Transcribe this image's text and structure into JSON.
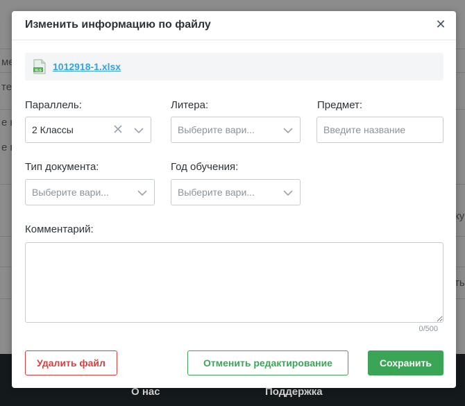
{
  "background": {
    "fragments": [
      "ме",
      "те",
      "е н",
      "е н",
      "ку",
      "ть"
    ],
    "footer": {
      "about": "О нас",
      "support": "Поддержка"
    }
  },
  "modal": {
    "title": "Изменить информацию по файлу",
    "close_glyph": "✕",
    "file": {
      "name": "1012918-1.xlsx",
      "icon_label": "XLS"
    },
    "fields": {
      "parallel": {
        "label": "Параллель:",
        "value": "2 Классы"
      },
      "litera": {
        "label": "Литера:",
        "placeholder": "Выберите вари..."
      },
      "subject": {
        "label": "Предмет:",
        "placeholder": "Введите название"
      },
      "doc_type": {
        "label": "Тип документа:",
        "placeholder": "Выберите вари..."
      },
      "year": {
        "label": "Год обучения:",
        "placeholder": "Выберите вари..."
      },
      "comment": {
        "label": "Комментарий:",
        "value": "",
        "counter": "0/500"
      }
    },
    "buttons": {
      "delete": "Удалить файл",
      "cancel": "Отменить редактирование",
      "save": "Сохранить"
    }
  },
  "colors": {
    "accent_green": "#3aa655",
    "danger_red": "#e03b3b",
    "link_blue": "#2fa3e8"
  }
}
